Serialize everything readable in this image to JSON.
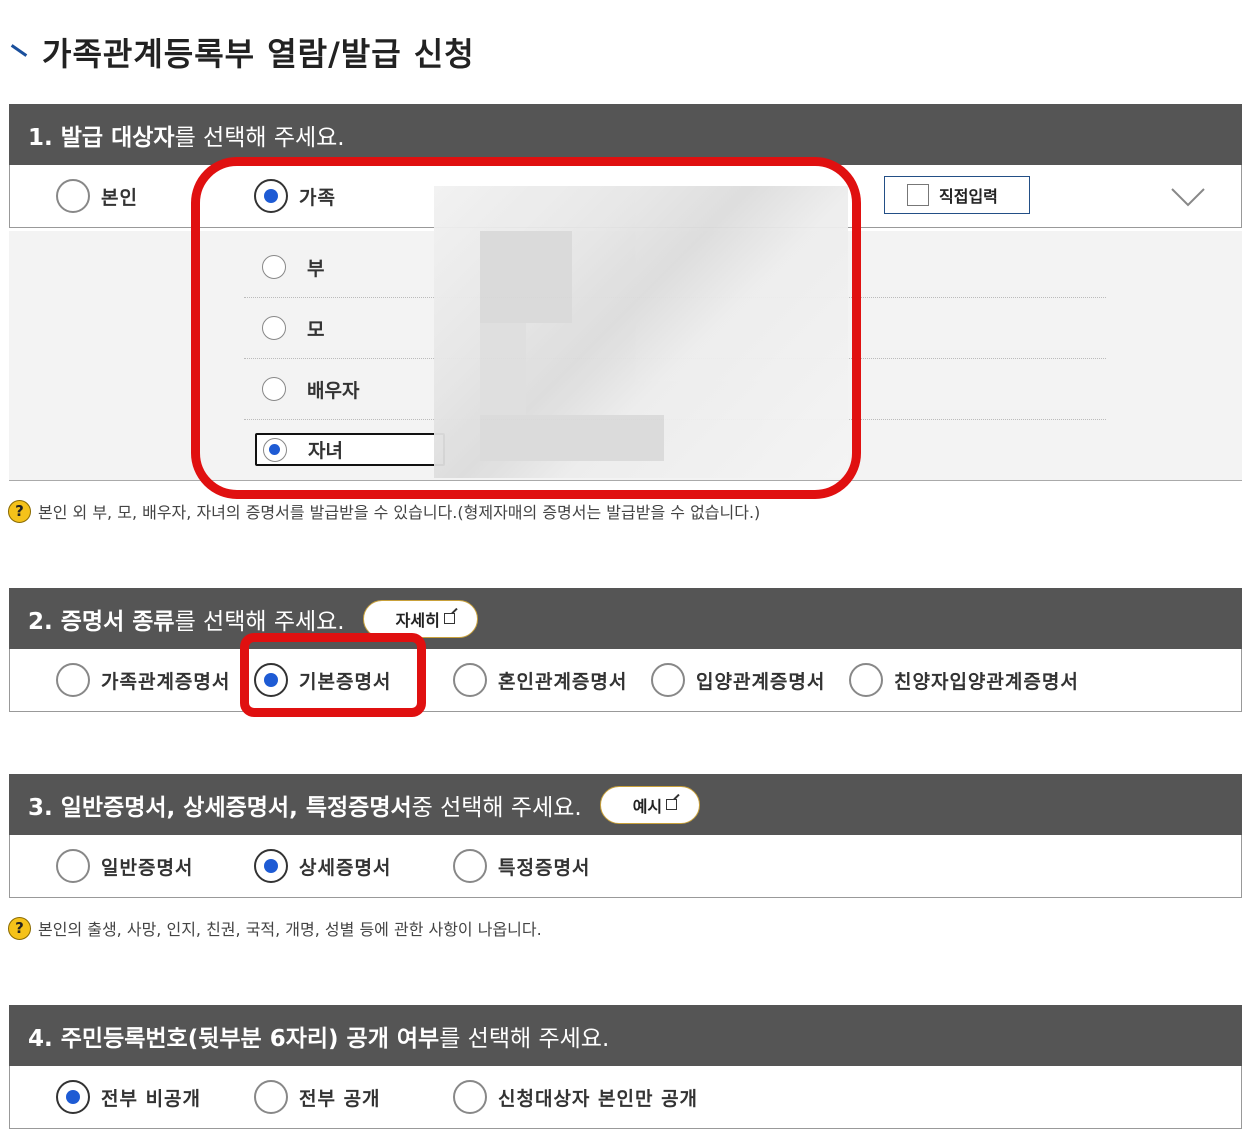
{
  "page": {
    "title": "가족관계등록부 열람/발급 신청"
  },
  "section1": {
    "heading_bold": "1. 발급 대상자",
    "heading_rest": "를 선택해 주세요.",
    "options": [
      {
        "label": "본인",
        "checked": false
      },
      {
        "label": "가족",
        "checked": true
      }
    ],
    "direct_input_label": "직접입력",
    "family_options": [
      {
        "label": "부",
        "checked": false
      },
      {
        "label": "모",
        "checked": false
      },
      {
        "label": "배우자",
        "checked": false
      },
      {
        "label": "자녀",
        "checked": true
      }
    ],
    "note": "본인 외 부, 모, 배우자, 자녀의 증명서를 발급받을 수 있습니다.(형제자매의 증명서는 발급받을 수 없습니다.)"
  },
  "section2": {
    "heading_bold": "2. 증명서 종류",
    "heading_rest": "를 선택해 주세요.",
    "pill_label": "자세히",
    "options": [
      {
        "label": "가족관계증명서",
        "checked": false
      },
      {
        "label": "기본증명서",
        "checked": true
      },
      {
        "label": "혼인관계증명서",
        "checked": false
      },
      {
        "label": "입양관계증명서",
        "checked": false
      },
      {
        "label": "친양자입양관계증명서",
        "checked": false
      }
    ]
  },
  "section3": {
    "heading_bold": "3. 일반증명서, 상세증명서, 특정증명서",
    "heading_rest": " 중 선택해 주세요.",
    "pill_label": "예시",
    "options": [
      {
        "label": "일반증명서",
        "checked": false
      },
      {
        "label": "상세증명서",
        "checked": true
      },
      {
        "label": "특정증명서",
        "checked": false
      }
    ],
    "note": "본인의 출생, 사망, 인지, 친권, 국적, 개명, 성별 등에 관한 사항이 나옵니다."
  },
  "section4": {
    "heading_bold": "4. 주민등록번호(뒷부분 6자리) 공개 여부",
    "heading_rest": "를 선택해 주세요.",
    "options": [
      {
        "label": "전부 비공개",
        "checked": true
      },
      {
        "label": "전부 공개",
        "checked": false
      },
      {
        "label": "신청대상자 본인만 공개",
        "checked": false
      }
    ]
  },
  "colors": {
    "header_bg": "#555555",
    "accent_blue": "#1e5bd4",
    "highlight_red": "#e01010",
    "pill_border": "#c9a13a"
  },
  "icons": [
    "title-tick-icon",
    "chevron-down-icon",
    "external-link-icon",
    "question-icon"
  ]
}
